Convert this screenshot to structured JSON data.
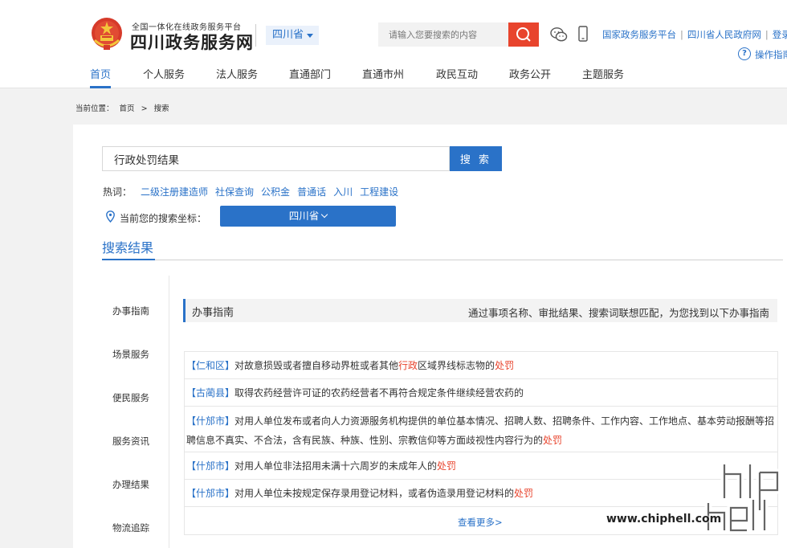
{
  "header": {
    "brand_sub": "全国一体化在线政务服务平台",
    "brand_main": "四川政务服务网",
    "province": "四川省",
    "search_placeholder": "请输入您要搜索的内容",
    "links": [
      "国家政务服务平台",
      "四川省人民政府网",
      "登录"
    ],
    "help_label": "操作指南"
  },
  "nav": [
    "首页",
    "个人服务",
    "法人服务",
    "直通部门",
    "直通市州",
    "政民互动",
    "政务公开",
    "主题服务"
  ],
  "breadcrumb": {
    "label": "当前位置：",
    "home": "首页",
    "sep": ">",
    "current": "搜索"
  },
  "search": {
    "query": "行政处罚结果",
    "button": "搜 索",
    "hot_label": "热词：",
    "hot_words": [
      "二级注册建造师",
      "社保查询",
      "公积金",
      "普通话",
      "入川",
      "工程建设"
    ],
    "location_label": "当前您的搜索坐标：",
    "location_value": "四川省"
  },
  "results": {
    "title": "搜索结果",
    "categories": [
      "办事指南",
      "场景服务",
      "便民服务",
      "服务资讯",
      "办理结果",
      "物流追踪"
    ],
    "guide_title": "办事指南",
    "guide_desc": "通过事项名称、审批结果、搜索词联想匹配，为您找到以下办事指南",
    "items": [
      {
        "region": "【仁和区】",
        "parts": [
          "对故意损毁或者擅自移动界桩或者其他",
          "行政",
          "区域界线标志物的",
          "处罚"
        ]
      },
      {
        "region": "【古蔺县】",
        "parts": [
          "取得农药经营许可证的农药经营者不再符合规定条件继续经营农药的",
          "",
          "",
          ""
        ]
      },
      {
        "region": "【什邡市】",
        "parts": [
          "对用人单位发布或者向人力资源服务机构提供的单位基本情况、招聘人数、招聘条件、工作内容、工作地点、基本劳动报酬等招聘信息不真实、不合法，含有民族、种族、性别、宗教信仰等方面歧视性内容行为的",
          "处罚",
          "",
          ""
        ]
      },
      {
        "region": "【什邡市】",
        "parts": [
          "对用人单位非法招用未满十六周岁的未成年人的",
          "处罚",
          "",
          ""
        ]
      },
      {
        "region": "【什邡市】",
        "parts": [
          "对用人单位未按规定保存录用登记材料，或者伪造录用登记材料的",
          "处罚",
          "",
          ""
        ]
      }
    ],
    "more": "查看更多>"
  },
  "watermark": "www.chiphell.com",
  "colors": {
    "primary": "#2a72c8",
    "accent": "#e8442d"
  }
}
